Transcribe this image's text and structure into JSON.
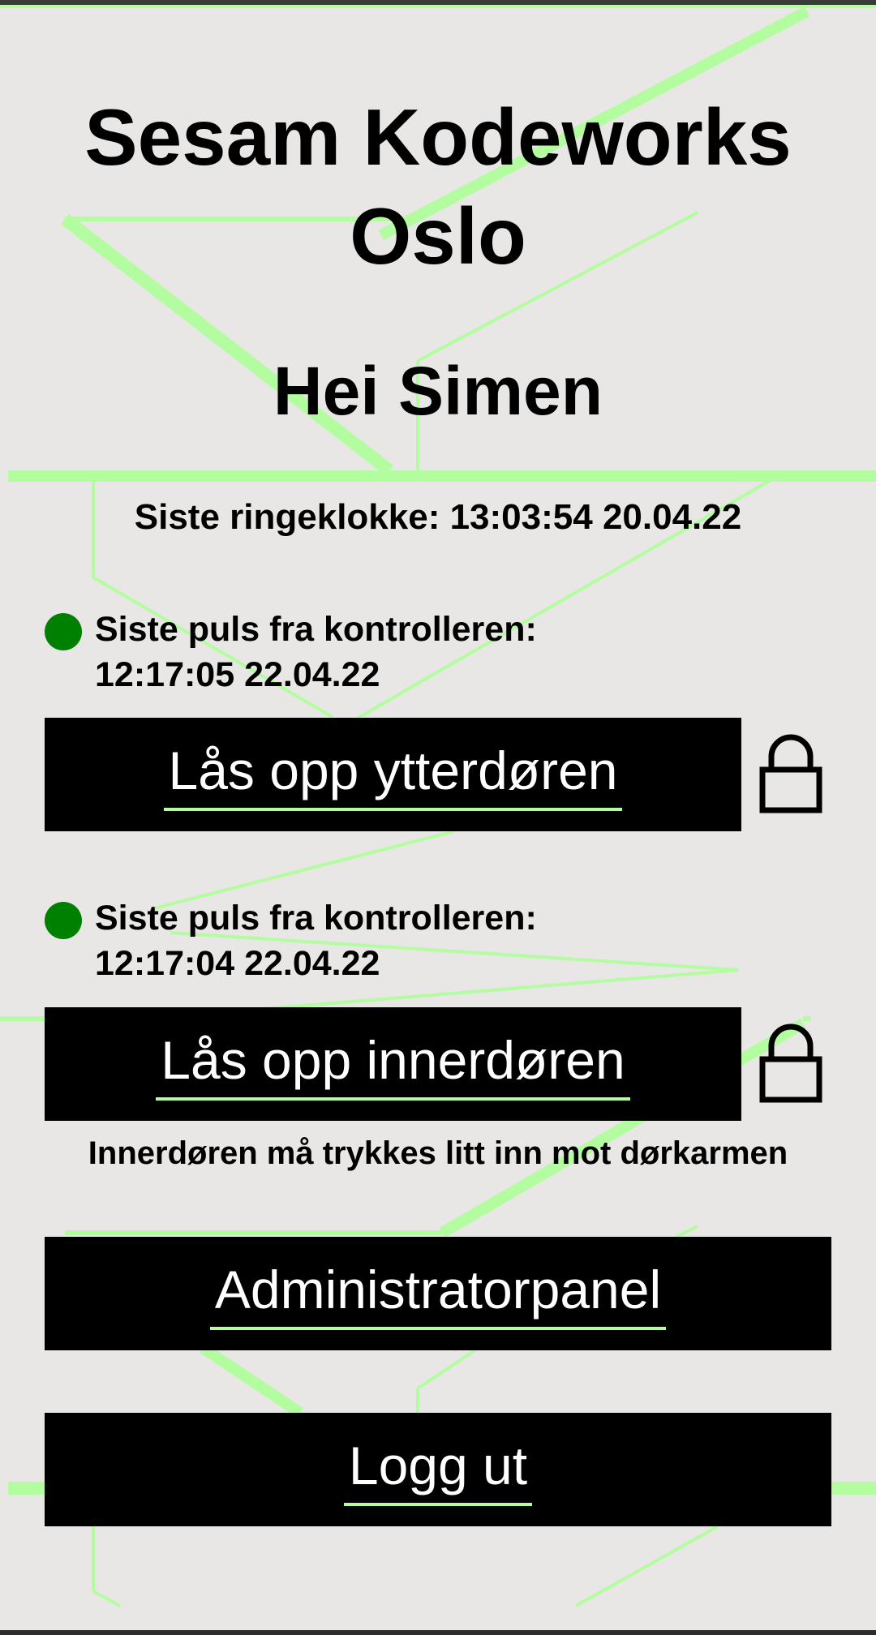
{
  "header": {
    "title": "Sesam Kodeworks Oslo",
    "greeting": "Hei Simen"
  },
  "doorbell": {
    "text": "Siste ringeklokke: 13:03:54 20.04.22"
  },
  "doors": [
    {
      "pulse_label": "Siste puls fra kontrolleren:",
      "pulse_time": "12:17:05 22.04.22",
      "status_color": "#008000",
      "button_label": "Lås opp ytterdøren",
      "lock_icon": "lock-icon"
    },
    {
      "pulse_label": "Siste puls fra kontrolleren:",
      "pulse_time": "12:17:04 22.04.22",
      "status_color": "#008000",
      "button_label": "Lås opp innerdøren",
      "lock_icon": "lock-icon",
      "note": "Innerdøren må trykkes litt inn mot dørkarmen"
    }
  ],
  "actions": {
    "admin_label": "Administratorpanel",
    "logout_label": "Logg ut"
  },
  "colors": {
    "background": "#e8e7e5",
    "accent": "#b4fca0",
    "button": "#000000",
    "status_ok": "#008000"
  }
}
